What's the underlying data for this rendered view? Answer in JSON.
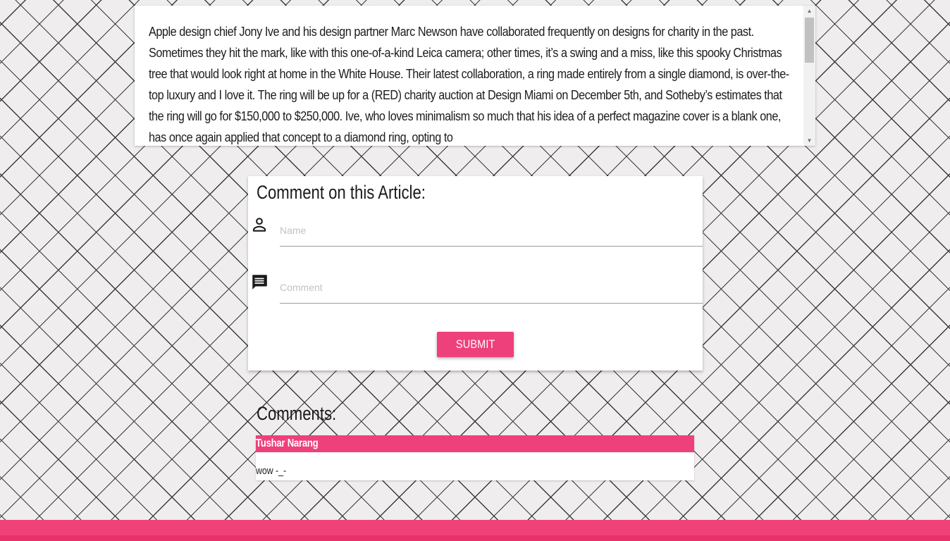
{
  "article": {
    "text": "Apple design chief Jony Ive and his design partner Marc Newson have collaborated frequently on designs for charity in the past. Sometimes they hit the mark, like with this one-of-a-kind Leica camera; other times, it’s a swing and a miss, like this spooky Christmas tree that would look right at home in the White House. Their latest collaboration, a ring made entirely from a single diamond, is over-the-top luxury and I love it. The ring will be up for a (RED) charity auction at Design Miami on December 5th, and Sotheby’s estimates that the ring will go for $150,000 to $250,000. Ive, who loves minimalism so much that his idea of a perfect magazine cover is a blank one, has once again applied that concept to a diamond ring, opting to"
  },
  "comment_form": {
    "heading": "Comment on this Article:",
    "name_placeholder": "Name",
    "comment_placeholder": "Comment",
    "submit_label": "SUBMIT",
    "person_icon": "person-outline-icon",
    "comment_icon": "comment-icon"
  },
  "comments": {
    "heading": "Comments:",
    "items": [
      {
        "author": "Tushar Narang",
        "text": "wow -_-"
      }
    ]
  },
  "colors": {
    "accent": "#ee407a",
    "footer": "#ef4279"
  }
}
